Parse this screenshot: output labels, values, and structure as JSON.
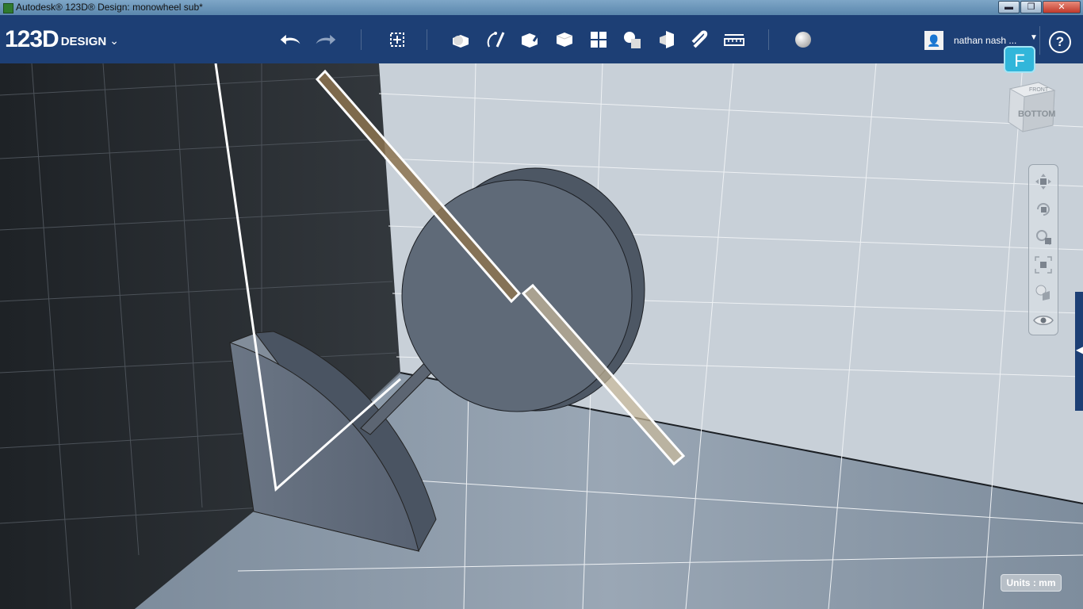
{
  "window": {
    "title": "Autodesk® 123D® Design: monowheel sub*",
    "minimize": "▬",
    "maximize": "❐",
    "close": "✕"
  },
  "toolbar": {
    "logo_main": "123D",
    "logo_sub": "DESIGN",
    "logo_chevron": "⌄",
    "icons": [
      "undo-icon",
      "redo-icon",
      "transform-icon",
      "primitives-icon",
      "sketch-icon",
      "construct-icon",
      "modify-icon",
      "pattern-icon",
      "grouping-icon",
      "combine-icon",
      "snap-icon",
      "measure-icon",
      "material-icon"
    ],
    "user_name": "nathan nash ...",
    "help": "?"
  },
  "badge": {
    "letter": "F"
  },
  "viewcube": {
    "face_label": "BOTTOM",
    "top_label": "FRONT"
  },
  "navbar": {
    "icons": [
      "pan-icon",
      "orbit-icon",
      "zoom-icon",
      "fit-icon",
      "view-mode-icon",
      "visibility-eye-icon"
    ]
  },
  "status": {
    "units": "Units : mm"
  },
  "colors": {
    "toolbar_bg": "#1d3f75",
    "dark_wall": "#262a2e",
    "light_wall": "#c8d0d8",
    "floor": "#8796a6",
    "model_face": "#5f6a78",
    "selection_fill": "#8c7350",
    "accent_badge": "#31b6da"
  }
}
